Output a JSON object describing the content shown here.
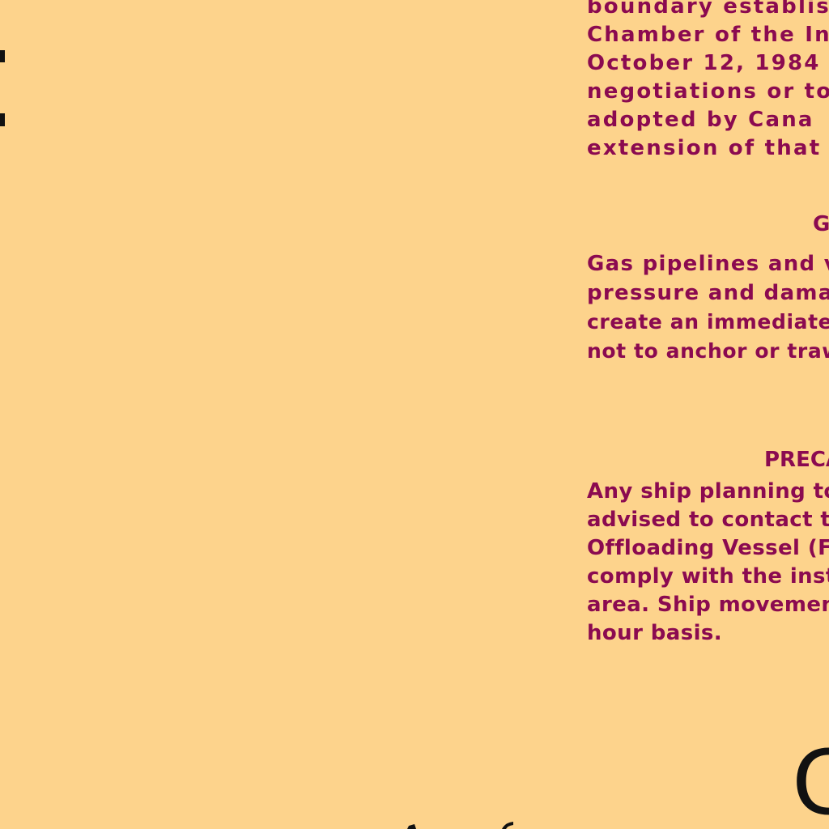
{
  "colors": {
    "background": "#FDD38C",
    "text": "#8B0A50",
    "map_ink": "#111111"
  },
  "boundary_note": {
    "lines": [
      "boundary establis",
      "Chamber of the Int",
      "October 12, 1984",
      "negotiations or to",
      "adopted by Cana",
      "extension of that l"
    ]
  },
  "gas_section": {
    "heading": "G",
    "lines": [
      "Gas pipelines and v",
      "pressure and dama",
      "create an immediate",
      "not to anchor or traw"
    ]
  },
  "precaution_section": {
    "heading": "PRECA",
    "lines": [
      "Any ship planning to",
      "advised to contact th",
      "Offloading Vessel (F",
      "comply with the instr",
      "area. Ship movemen",
      "hour basis."
    ]
  },
  "map_labels": {
    "large_letter": "C"
  }
}
